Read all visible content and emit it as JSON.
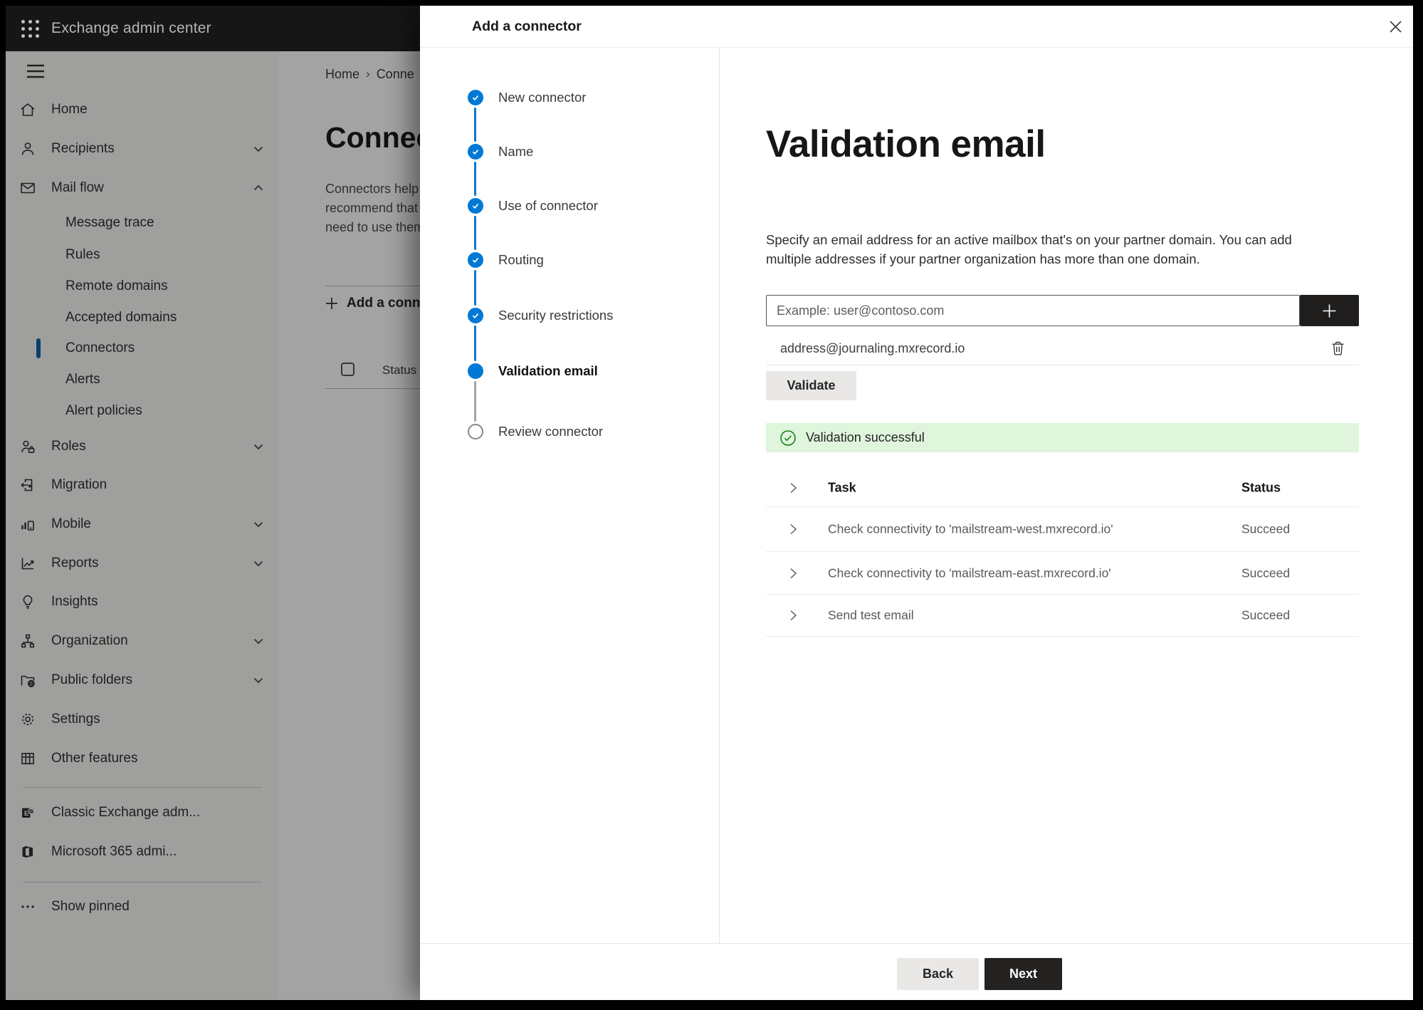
{
  "header": {
    "app_title": "Exchange admin center"
  },
  "sidebar": {
    "items": [
      {
        "label": "Home"
      },
      {
        "label": "Recipients"
      },
      {
        "label": "Mail flow"
      },
      {
        "label": "Message trace"
      },
      {
        "label": "Rules"
      },
      {
        "label": "Remote domains"
      },
      {
        "label": "Accepted domains"
      },
      {
        "label": "Connectors"
      },
      {
        "label": "Alerts"
      },
      {
        "label": "Alert policies"
      },
      {
        "label": "Roles"
      },
      {
        "label": "Migration"
      },
      {
        "label": "Mobile"
      },
      {
        "label": "Reports"
      },
      {
        "label": "Insights"
      },
      {
        "label": "Organization"
      },
      {
        "label": "Public folders"
      },
      {
        "label": "Settings"
      },
      {
        "label": "Other features"
      },
      {
        "label": "Classic Exchange adm..."
      },
      {
        "label": "Microsoft 365 admi..."
      },
      {
        "label": "Show pinned"
      }
    ]
  },
  "background": {
    "breadcrumb": {
      "home": "Home",
      "separator": "›",
      "current": "Conne"
    },
    "page_title": "Connectors",
    "description_lines": [
      "Connectors help",
      "recommend that",
      "need to use them"
    ],
    "add_button_label": "Add a connector",
    "status_header": "Status"
  },
  "dialog": {
    "title": "Add a connector",
    "wizard": {
      "steps": [
        {
          "label": "New connector",
          "state": "done"
        },
        {
          "label": "Name",
          "state": "done"
        },
        {
          "label": "Use of connector",
          "state": "done"
        },
        {
          "label": "Routing",
          "state": "done"
        },
        {
          "label": "Security restrictions",
          "state": "done"
        },
        {
          "label": "Validation email",
          "state": "current"
        },
        {
          "label": "Review connector",
          "state": "pending"
        }
      ]
    },
    "content": {
      "heading": "Validation email",
      "description": "Specify an email address for an active mailbox that's on your partner domain. You can add multiple addresses if your partner organization has more than one domain.",
      "email_placeholder": "Example: user@contoso.com",
      "added_address": "address@journaling.mxrecord.io",
      "validate_label": "Validate",
      "success_message": "Validation successful",
      "table": {
        "task_header": "Task",
        "status_header": "Status",
        "rows": [
          {
            "task": "Check connectivity to 'mailstream-west.mxrecord.io'",
            "status": "Succeed"
          },
          {
            "task": "Check connectivity to 'mailstream-east.mxrecord.io'",
            "status": "Succeed"
          },
          {
            "task": "Send test email",
            "status": "Succeed"
          }
        ]
      }
    },
    "footer": {
      "back_label": "Back",
      "next_label": "Next"
    }
  },
  "colors": {
    "accent": "#0078d4",
    "success_bg": "#dff6dd",
    "success_icon": "#107c10",
    "primary_button": "#242322"
  }
}
